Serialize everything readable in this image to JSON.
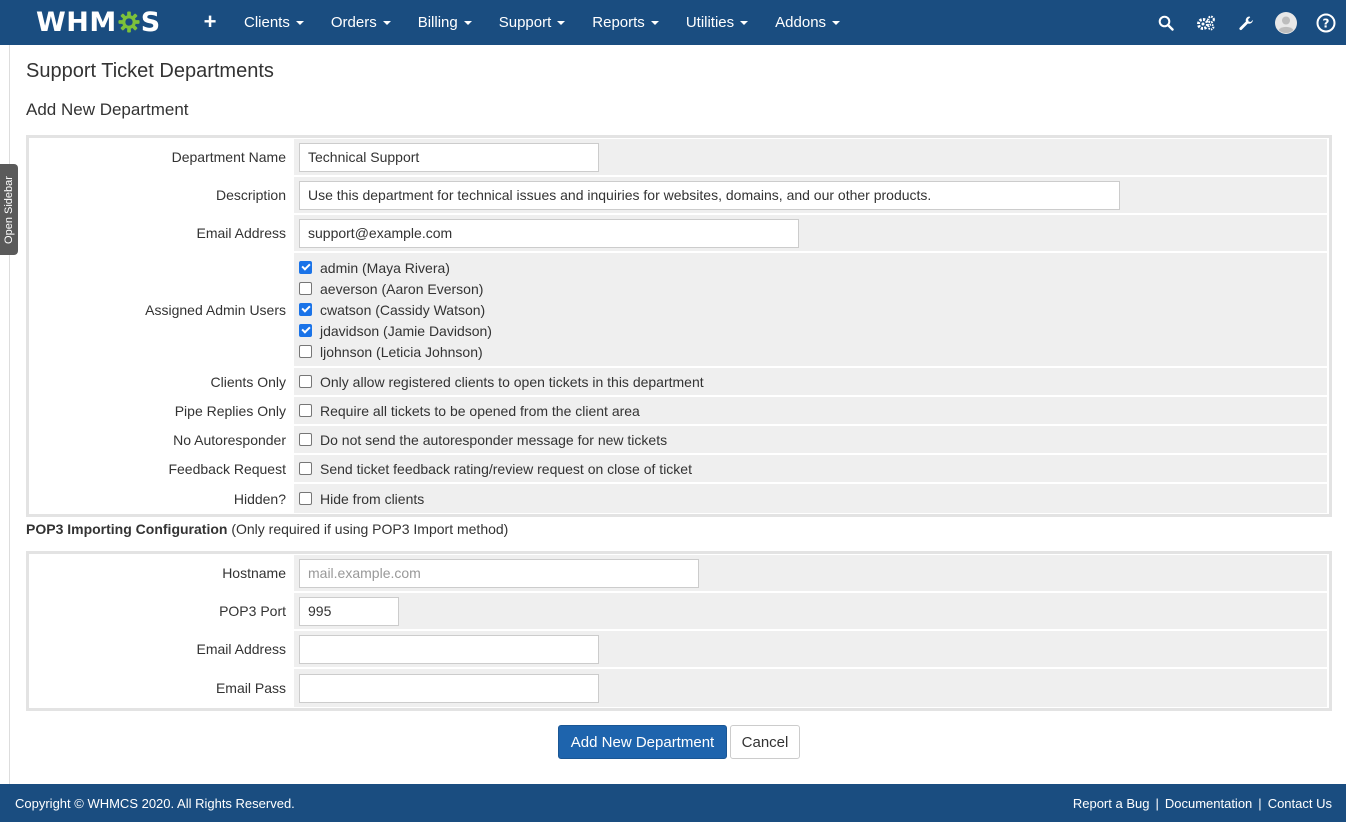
{
  "brand": {
    "logo_text_left": "WHM",
    "logo_text_right": "S"
  },
  "nav": {
    "items": [
      "Clients",
      "Orders",
      "Billing",
      "Support",
      "Reports",
      "Utilities",
      "Addons"
    ],
    "icons": [
      "search-icon",
      "gears-icon",
      "wrench-icon",
      "user-avatar-icon",
      "help-icon"
    ]
  },
  "sidebar": {
    "toggle_label": "Open Sidebar"
  },
  "page": {
    "title": "Support Ticket Departments",
    "section_title": "Add New Department"
  },
  "department": {
    "name_label": "Department Name",
    "name_value": "Technical Support",
    "description_label": "Description",
    "description_value": "Use this department for technical issues and inquiries for websites, domains, and our other products.",
    "email_label": "Email Address",
    "email_value": "support@example.com",
    "admins_label": "Assigned Admin Users",
    "admins": [
      {
        "label": "admin (Maya Rivera)",
        "checked": true
      },
      {
        "label": "aeverson (Aaron Everson)",
        "checked": false
      },
      {
        "label": "cwatson (Cassidy Watson)",
        "checked": true
      },
      {
        "label": "jdavidson (Jamie Davidson)",
        "checked": true
      },
      {
        "label": "ljohnson (Leticia Johnson)",
        "checked": false
      }
    ],
    "options": [
      {
        "label": "Clients Only",
        "text": "Only allow registered clients to open tickets in this department",
        "checked": false
      },
      {
        "label": "Pipe Replies Only",
        "text": "Require all tickets to be opened from the client area",
        "checked": false
      },
      {
        "label": "No Autoresponder",
        "text": "Do not send the autoresponder message for new tickets",
        "checked": false
      },
      {
        "label": "Feedback Request",
        "text": "Send ticket feedback rating/review request on close of ticket",
        "checked": false
      },
      {
        "label": "Hidden?",
        "text": "Hide from clients",
        "checked": false
      }
    ]
  },
  "pop3": {
    "heading_bold": "POP3 Importing Configuration",
    "heading_note": "(Only required if using POP3 Import method)",
    "hostname_label": "Hostname",
    "hostname_placeholder": "mail.example.com",
    "port_label": "POP3 Port",
    "port_value": "995",
    "email_label": "Email Address",
    "email_value": "",
    "pass_label": "Email Pass",
    "pass_value": ""
  },
  "actions": {
    "submit_label": "Add New Department",
    "cancel_label": "Cancel"
  },
  "footer": {
    "copyright": "Copyright © WHMCS 2020. All Rights Reserved.",
    "links": [
      "Report a Bug",
      "Documentation",
      "Contact Us"
    ]
  },
  "colors": {
    "nav_bg": "#1a4d80",
    "primary_button": "#1e64ad",
    "checkbox_checked": "#1a73e8",
    "logo_gear": "#7cc13a"
  }
}
